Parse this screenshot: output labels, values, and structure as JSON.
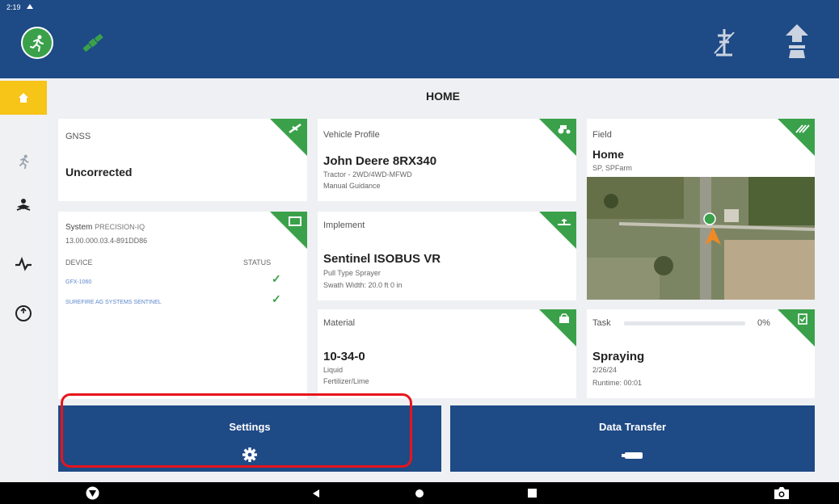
{
  "status_bar": {
    "time": "2:19"
  },
  "page_title": "HOME",
  "gnss": {
    "title": "GNSS",
    "status": "Uncorrected"
  },
  "system": {
    "title": "System",
    "product": "PRECISION-IQ",
    "version": "13.00.000.03.4-891DD86",
    "device_header": "DEVICE",
    "status_header": "STATUS",
    "devices": [
      {
        "name": "GFX-1060",
        "status": "ok"
      },
      {
        "name": "SUREFIRE AG SYSTEMS SENTINEL",
        "status": "ok"
      }
    ]
  },
  "vehicle": {
    "title": "Vehicle Profile",
    "name": "John Deere 8RX340",
    "type": "Tractor - 2WD/4WD-MFWD",
    "guidance": "Manual Guidance"
  },
  "implement": {
    "title": "Implement",
    "name": "Sentinel ISOBUS VR",
    "type": "Pull Type Sprayer",
    "swath": "Swath Width: 20.0 ft 0 in"
  },
  "material": {
    "title": "Material",
    "name": "10-34-0",
    "form": "Liquid",
    "category": "Fertilizer/Lime"
  },
  "field": {
    "title": "Field",
    "name": "Home",
    "location": "SP, SPFarm"
  },
  "task": {
    "title": "Task",
    "progress_percent": 0,
    "progress_label": "0%",
    "name": "Spraying",
    "date": "2/26/24",
    "runtime": "Runtime: 00:01"
  },
  "actions": {
    "settings": "Settings",
    "data_transfer": "Data Transfer"
  },
  "colors": {
    "header_blue": "#1e4a86",
    "accent_green": "#3aa14a",
    "active_yellow": "#f7c418",
    "highlight_red": "#e8141c"
  }
}
